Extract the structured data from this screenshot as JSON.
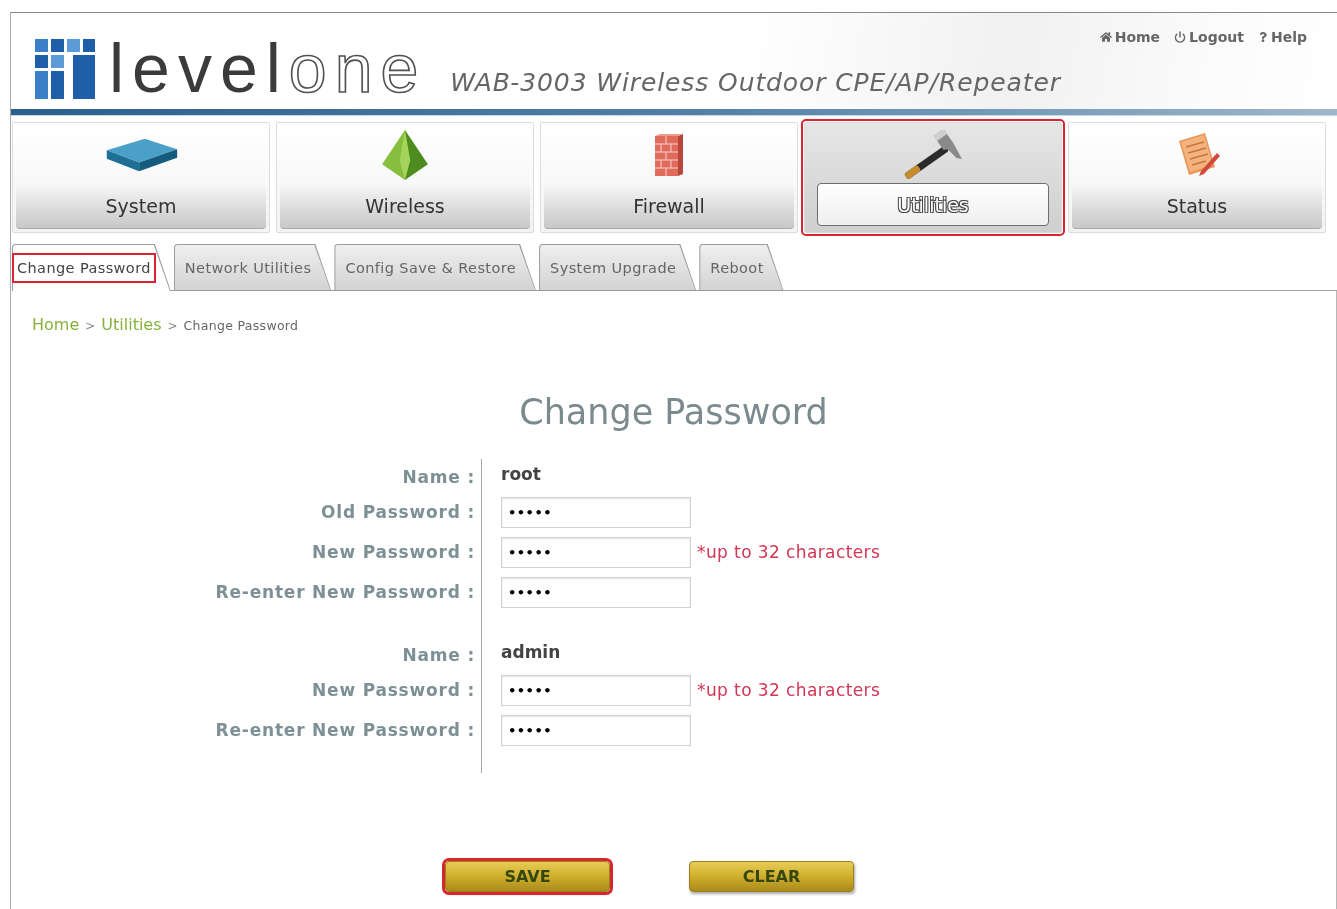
{
  "header": {
    "logo": [
      "level",
      "one"
    ],
    "product_title": "WAB-3003 Wireless Outdoor CPE/AP/Repeater",
    "links": [
      {
        "label": "Home"
      },
      {
        "label": "Logout"
      },
      {
        "label": "Help"
      }
    ]
  },
  "main_tabs": [
    {
      "label": "System",
      "selected": false,
      "highlighted": false
    },
    {
      "label": "Wireless",
      "selected": false,
      "highlighted": false
    },
    {
      "label": "Firewall",
      "selected": false,
      "highlighted": false
    },
    {
      "label": "Utilities",
      "selected": true,
      "highlighted": true
    },
    {
      "label": "Status",
      "selected": false,
      "highlighted": false
    }
  ],
  "sub_tabs": [
    {
      "label": "Change Password",
      "selected": true,
      "highlighted": true
    },
    {
      "label": "Network Utilities",
      "selected": false,
      "highlighted": false
    },
    {
      "label": "Config Save & Restore",
      "selected": false,
      "highlighted": false
    },
    {
      "label": "System Upgrade",
      "selected": false,
      "highlighted": false
    },
    {
      "label": "Reboot",
      "selected": false,
      "highlighted": false
    }
  ],
  "breadcrumb": [
    {
      "kind": "link",
      "label": "Home"
    },
    {
      "kind": "separator",
      "label": ">"
    },
    {
      "kind": "link",
      "label": "Utilities"
    },
    {
      "kind": "separator",
      "label": ">"
    },
    {
      "kind": "current",
      "label": "Change Password"
    }
  ],
  "form": {
    "title": "Change Password",
    "groups": [
      {
        "rows": [
          {
            "kind": "text",
            "label": "Name :",
            "value": "root"
          },
          {
            "kind": "password",
            "label": "Old Password :",
            "value": "•••••"
          },
          {
            "kind": "password",
            "label": "New Password :",
            "value": "•••••",
            "hint": "*up to 32 characters"
          },
          {
            "kind": "password",
            "label": "Re-enter New Password :",
            "value": "•••••"
          }
        ]
      },
      {
        "rows": [
          {
            "kind": "text",
            "label": "Name :",
            "value": "admin"
          },
          {
            "kind": "password",
            "label": "New Password :",
            "value": "•••••",
            "hint": "*up to 32 characters"
          },
          {
            "kind": "password",
            "label": "Re-enter New Password :",
            "value": "•••••"
          }
        ]
      }
    ]
  },
  "buttons": [
    {
      "label": "SAVE",
      "highlighted": true
    },
    {
      "label": "CLEAR",
      "highlighted": false
    }
  ]
}
